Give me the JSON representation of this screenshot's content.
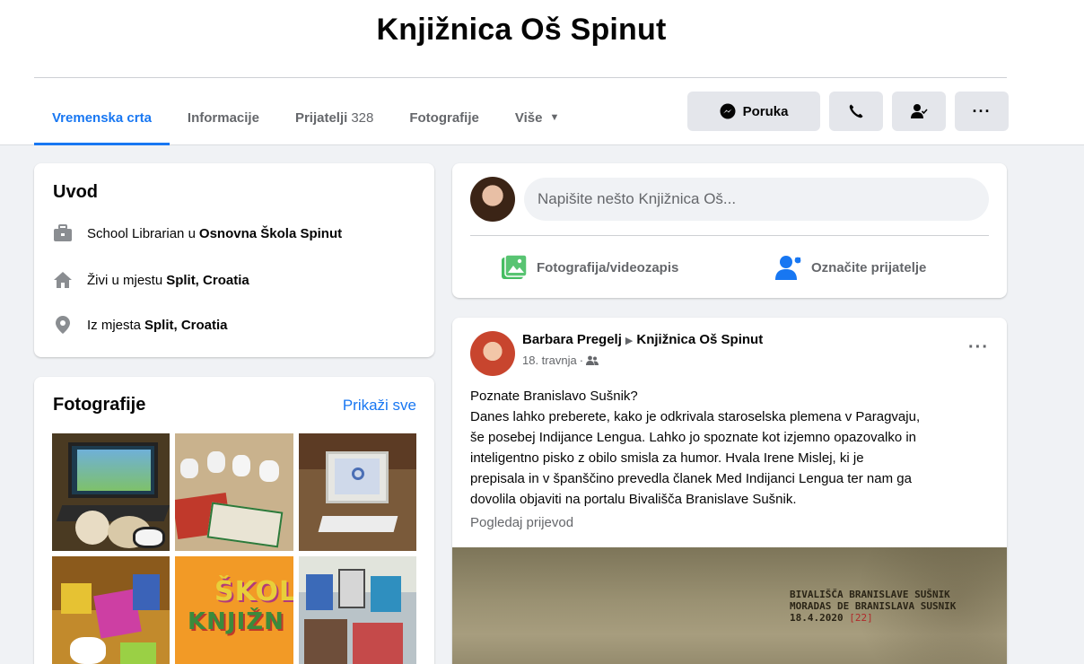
{
  "page": {
    "title": "Knjižnica Oš Spinut"
  },
  "tabs": [
    {
      "label": "Vremenska crta",
      "active": true
    },
    {
      "label": "Informacije"
    },
    {
      "label": "Prijatelji",
      "count": "328"
    },
    {
      "label": "Fotografije"
    },
    {
      "label": "Više",
      "icon": "caret-down-icon"
    }
  ],
  "actions": {
    "message_label": "Poruka",
    "icons": [
      "messenger-icon",
      "phone-icon",
      "friend-status-icon",
      "more-icon"
    ]
  },
  "intro": {
    "title": "Uvod",
    "rows": [
      {
        "icon": "briefcase-icon",
        "prefix": "School Librarian u",
        "value": "Osnovna Škola Spinut"
      },
      {
        "icon": "home-icon",
        "prefix": "Živi u mjestu",
        "value": "Split, Croatia"
      },
      {
        "icon": "location-pin-icon",
        "prefix": "Iz mjesta",
        "value": "Split, Croatia"
      }
    ]
  },
  "photos": {
    "title": "Fotografije",
    "see_all": "Prikaži sve"
  },
  "composer": {
    "placeholder": "Napišite nešto Knjižnica Oš...",
    "photo_video": "Fotografija/videozapis",
    "tag_friends": "Označite prijatelje"
  },
  "post": {
    "author": "Barbara Pregelj",
    "target": "Knjižnica Oš Spinut",
    "date": "18. travnja",
    "audience_icon": "friends-icon",
    "lines": [
      "Poznate Branislavo Sušnik?",
      "Danes lahko preberete, kako je odkrivala staroselska plemena v Paragvaju,",
      "še posebej Indijance Lengua. Lahko jo spoznate kot izjemno opazovalko in",
      "inteligentno pisko z obilo smisla za humor. Hvala Irene Mislej, ki je",
      "prepisala in v španščino prevedla članek Med Indijanci Lengua ter nam ga",
      "dovolila objaviti na portalu Bivališča Branislave Sušnik."
    ],
    "see_translation": "Pogledaj prijevod",
    "image_text": {
      "line1": "BIVALIŠČA BRANISLAVE SUŠNIK",
      "line2": "MORADAS DE BRANISLAVA SUSNIK",
      "date": "18.4.2020",
      "tag": "[22]"
    }
  },
  "colors": {
    "accent": "#1877f2",
    "background": "#f0f2f5",
    "secondary_text": "#65676b",
    "button_bg": "#e4e6eb"
  }
}
